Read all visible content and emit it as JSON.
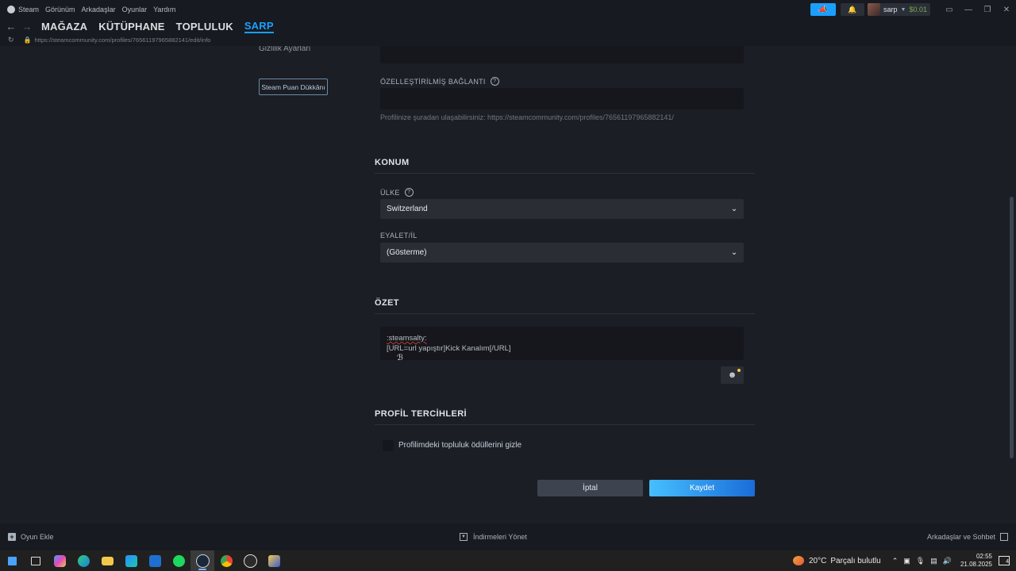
{
  "menubar": {
    "items": [
      "Steam",
      "Görünüm",
      "Arkadaşlar",
      "Oyunlar",
      "Yardım"
    ]
  },
  "account": {
    "username": "sarp",
    "balance": "$0.01"
  },
  "nav": {
    "store": "MAĞAZA",
    "library": "KÜTÜPHANE",
    "community": "TOPLULUK",
    "profile": "SARP"
  },
  "url": "https://steamcommunity.com/profiles/76561197965882141/edit/info",
  "sidebar": {
    "privacy_link": "Gizlilik Ayarları",
    "points_shop": "Steam Puan Dükkânı"
  },
  "custom_url": {
    "label": "ÖZELLEŞTİRİLMİŞ BAĞLANTI",
    "value": "",
    "hint": "Profilinize şuradan ulaşabilirsiniz: https://steamcommunity.com/profiles/76561197965882141/"
  },
  "location": {
    "section_title": "KONUM",
    "country_label": "ÜLKE",
    "country_value": "Switzerland",
    "state_label": "EYALET/İL",
    "state_value": "(Gösterme)"
  },
  "summary": {
    "section_title": "ÖZET",
    "line1": ":steamsalty:",
    "line2": "[URL=url yapıştır]Kick Kanalım[/URL]"
  },
  "preferences": {
    "section_title": "PROFİL TERCİHLERİ",
    "hide_awards_label": "Profilimdeki topluluk ödüllerini gizle",
    "hide_awards_checked": false
  },
  "actions": {
    "cancel": "İptal",
    "save": "Kaydet"
  },
  "bottombar": {
    "add_game": "Oyun Ekle",
    "downloads": "İndirmeleri Yönet",
    "friends": "Arkadaşlar ve Sohbet"
  },
  "taskbar": {
    "weather_temp": "20°C",
    "weather_desc": "Parçalı bulutlu",
    "time": "02:55",
    "date": "21.08.2025",
    "notification_count": "4"
  },
  "colors": {
    "accent": "#1a9fff",
    "background": "#1b1e25",
    "topbar": "#171a21"
  }
}
